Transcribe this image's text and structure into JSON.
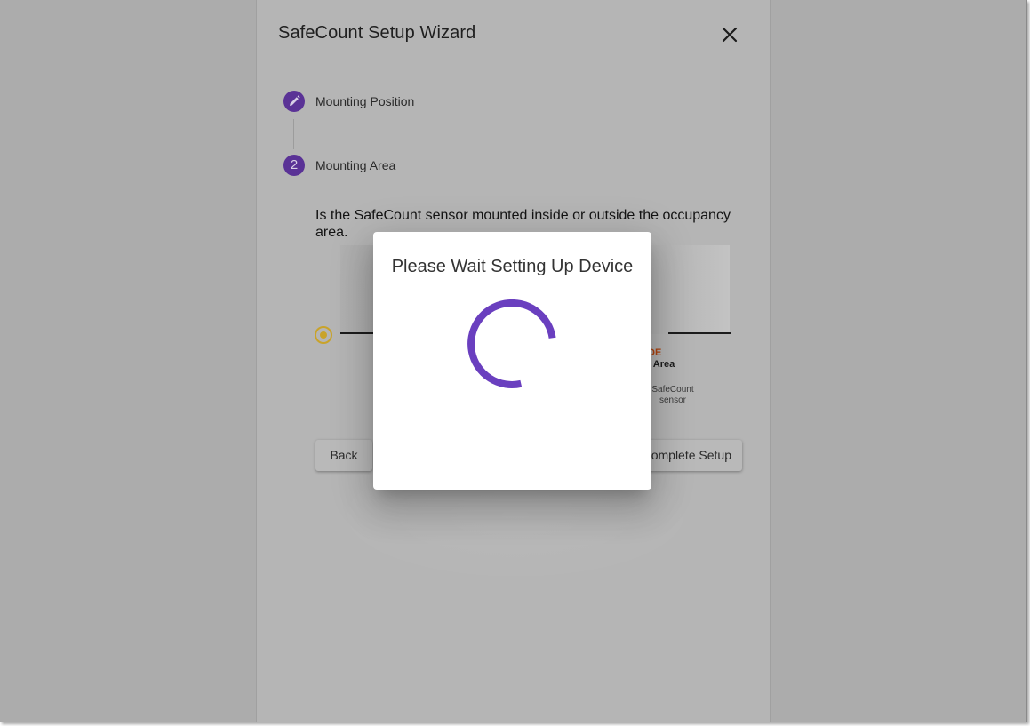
{
  "wizard": {
    "title": "SafeCount Setup Wizard",
    "close_icon": "close-icon",
    "steps": [
      {
        "index": "",
        "icon": "pencil-icon",
        "label": "Mounting Position",
        "state": "completed"
      },
      {
        "index": "2",
        "label": "Mounting Area",
        "state": "active"
      }
    ],
    "question": "Is the SafeCount sensor mounted inside or outside the occupancy area.",
    "diagram": {
      "tag": "DE",
      "area_name": "y Area",
      "sensor_caption": "SafeCount sensor",
      "radio_selected": true
    },
    "buttons": {
      "back": "Back",
      "complete": "omplete Setup"
    }
  },
  "modal": {
    "title": "Please Wait Setting Up Device",
    "spinner_icon": "loading-spinner-icon"
  },
  "colors": {
    "step_purple": "#5a3296",
    "spinner_purple": "#6a3fbf",
    "radio_gold": "#c9a32a",
    "area_tag_orange": "#b04410"
  }
}
